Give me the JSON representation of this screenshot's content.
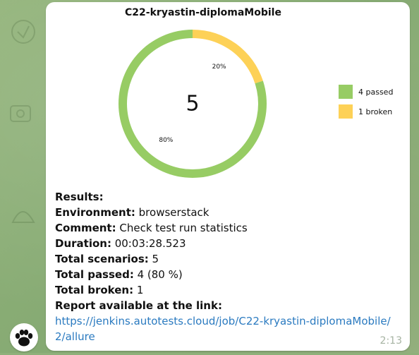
{
  "message": {
    "chart_title": "C22-kryastin-diplomaMobile",
    "lines": [
      {
        "label": "Results:",
        "value": ""
      },
      {
        "label": "Environment:",
        "value": " browserstack"
      },
      {
        "label": "Comment:",
        "value": " Check test run statistics"
      },
      {
        "label": "Duration:",
        "value": " 00:03:28.523"
      },
      {
        "label": "Total scenarios:",
        "value": " 5"
      },
      {
        "label": "Total passed:",
        "value": " 4 (80 %)"
      },
      {
        "label": "Total broken:",
        "value": " 1"
      },
      {
        "label": "Report available at the link:",
        "value": ""
      }
    ],
    "link": "https://jenkins.autotests.cloud/job/C22-kryastin-diplomaMobile/2/allure",
    "time": "2:13"
  },
  "chart_data": {
    "type": "pie",
    "title": "C22-kryastin-diplomaMobile",
    "center_label": "5",
    "slices": [
      {
        "name": "4 passed",
        "value": 4,
        "percent_label": "80%",
        "color": "#97cc64"
      },
      {
        "name": "1 broken",
        "value": 1,
        "percent_label": "20%",
        "color": "#fdd157"
      }
    ],
    "legend_position": "right"
  },
  "icons": {
    "avatar": "paw-icon"
  }
}
